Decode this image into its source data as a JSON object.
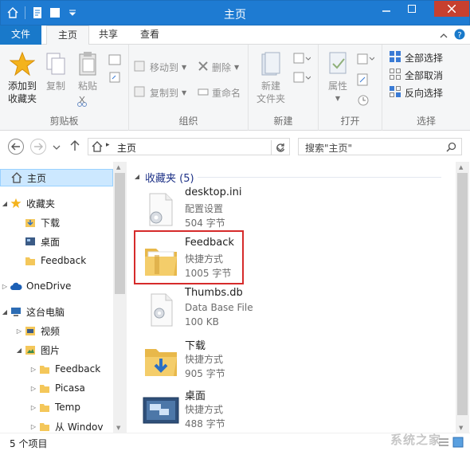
{
  "window": {
    "title": "主页"
  },
  "tabs": {
    "file": "文件",
    "home": "主页",
    "share": "共享",
    "view": "查看"
  },
  "ribbon": {
    "clipboard": {
      "group": "剪贴板",
      "pin_line1": "添加到",
      "pin_line2": "收藏夹",
      "copy": "复制",
      "paste": "粘贴"
    },
    "organize": {
      "group": "组织",
      "move_to": "移动到",
      "copy_to": "复制到",
      "delete": "删除",
      "rename": "重命名"
    },
    "new": {
      "group": "新建",
      "new_folder_line1": "新建",
      "new_folder_line2": "文件夹"
    },
    "open": {
      "group": "打开",
      "properties": "属性"
    },
    "select": {
      "group": "选择",
      "select_all": "全部选择",
      "select_none": "全部取消",
      "invert": "反向选择"
    }
  },
  "address": {
    "location": "主页",
    "search_placeholder": "搜索\"主页\""
  },
  "nav": {
    "home": "主页",
    "favorites": "收藏夹",
    "downloads": "下载",
    "desktop": "桌面",
    "feedback": "Feedback",
    "onedrive": "OneDrive",
    "this_pc": "这台电脑",
    "videos": "视频",
    "pictures": "图片",
    "pic_feedback": "Feedback",
    "picasa": "Picasa",
    "temp": "Temp",
    "from_windows": "从 Windov"
  },
  "content": {
    "group_title": "收藏夹 (5)",
    "items": [
      {
        "name": "desktop.ini",
        "type": "配置设置",
        "size": "504 字节"
      },
      {
        "name": "Feedback",
        "type": "快捷方式",
        "size": "1005 字节"
      },
      {
        "name": "Thumbs.db",
        "type": "Data Base File",
        "size": "100 KB"
      },
      {
        "name": "下载",
        "type": "快捷方式",
        "size": "905 字节"
      },
      {
        "name": "桌面",
        "type": "快捷方式",
        "size": "488 字节"
      }
    ]
  },
  "status": {
    "count": "5 个项目"
  },
  "watermark": "系统之家",
  "colors": {
    "titlebar": "#1e7bd2",
    "file_tab": "#1979ca",
    "highlight": "#d62b2b",
    "selected": "#cce8ff",
    "group_header": "#1e3287"
  }
}
